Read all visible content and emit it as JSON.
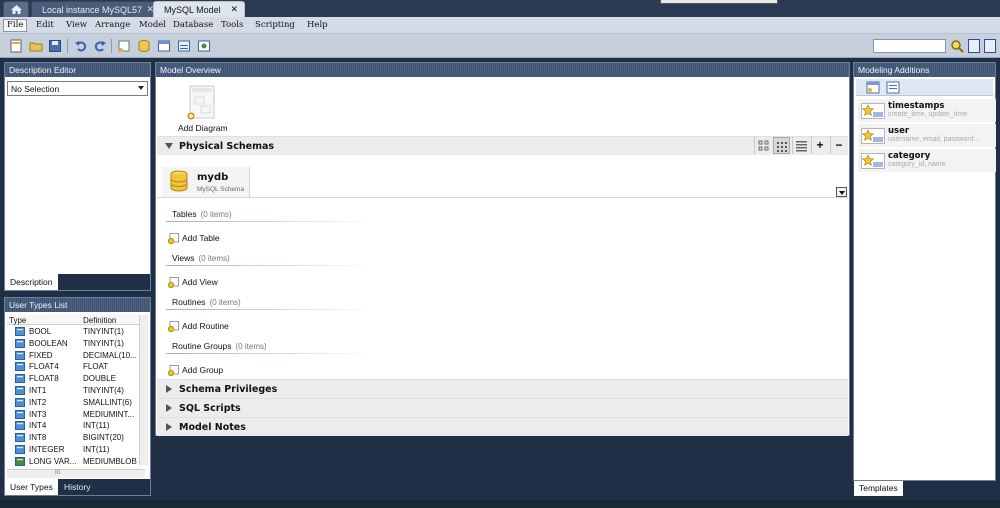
{
  "tabs": {
    "home_icon": "home-icon",
    "items": [
      {
        "label": "Local instance MySQL57",
        "close": "✕"
      },
      {
        "label": "MySQL Model",
        "close": "✕"
      }
    ]
  },
  "menu": [
    "File",
    "Edit",
    "View",
    "Arrange",
    "Model",
    "Database",
    "Tools",
    "Scripting",
    "Help"
  ],
  "description_editor": {
    "title": "Description Editor",
    "selection": "No Selection",
    "tab": "Description"
  },
  "user_types": {
    "title": "User Types List",
    "col_type": "Type",
    "col_definition": "Definition",
    "rows": [
      {
        "type": "BOOL",
        "definition": "TINYINT(1)"
      },
      {
        "type": "BOOLEAN",
        "definition": "TINYINT(1)"
      },
      {
        "type": "FIXED",
        "definition": "DECIMAL(10..."
      },
      {
        "type": "FLOAT4",
        "definition": "FLOAT"
      },
      {
        "type": "FLOAT8",
        "definition": "DOUBLE"
      },
      {
        "type": "INT1",
        "definition": "TINYINT(4)"
      },
      {
        "type": "INT2",
        "definition": "SMALLINT(6)"
      },
      {
        "type": "INT3",
        "definition": "MEDIUMINT..."
      },
      {
        "type": "INT4",
        "definition": "INT(11)"
      },
      {
        "type": "INT8",
        "definition": "BIGINT(20)"
      },
      {
        "type": "INTEGER",
        "definition": "INT(11)"
      },
      {
        "type": "LONG VAR...",
        "definition": "MEDIUMBLOB"
      }
    ],
    "scroll_mark": "III",
    "tabs": [
      "User Types",
      "History"
    ]
  },
  "model_overview": {
    "title": "Model Overview",
    "add_diagram": "Add Diagram",
    "physical_schemas": "Physical Schemas",
    "schema": {
      "name": "mydb",
      "subtitle": "MySQL Schema"
    },
    "groups": [
      {
        "label": "Tables",
        "count": "(0 items)",
        "add": "Add Table"
      },
      {
        "label": "Views",
        "count": "(0 items)",
        "add": "Add View"
      },
      {
        "label": "Routines",
        "count": "(0 items)",
        "add": "Add Routine"
      },
      {
        "label": "Routine Groups",
        "count": "(0 items)",
        "add": "Add Group"
      }
    ],
    "sections": [
      "Schema Privileges",
      "SQL Scripts",
      "Model Notes"
    ],
    "plus": "+",
    "minus": "−"
  },
  "modeling_additions": {
    "title": "Modeling Additions",
    "items": [
      {
        "title": "timestamps",
        "sub": "create_time, update_time"
      },
      {
        "title": "user",
        "sub": "username, email, password..."
      },
      {
        "title": "category",
        "sub": "category_id, name"
      }
    ],
    "tab": "Templates"
  },
  "colors": {
    "background": "#1f2f45",
    "header": "#3e5372",
    "section": "#ececec"
  }
}
